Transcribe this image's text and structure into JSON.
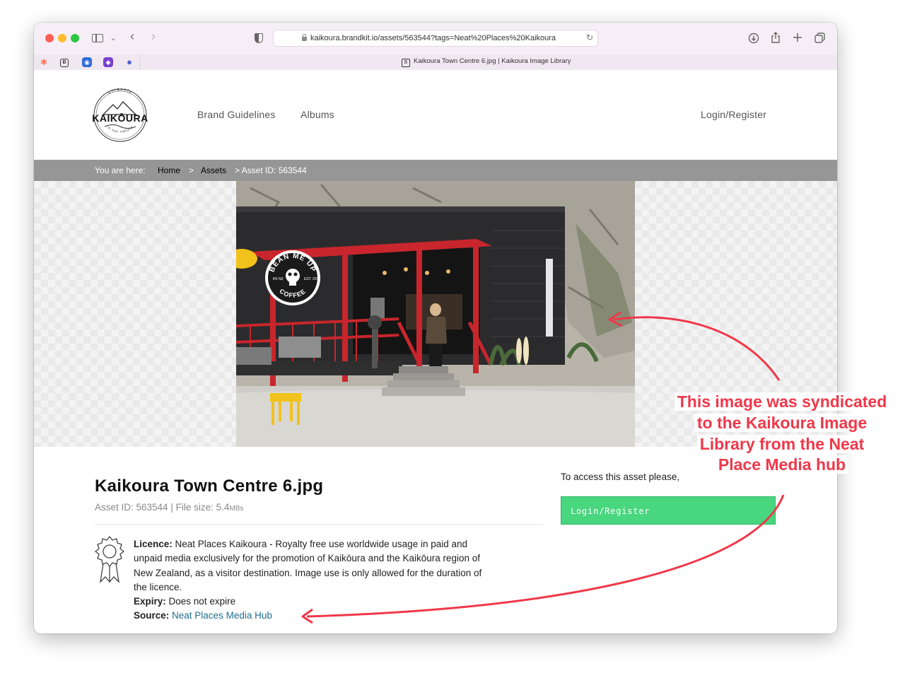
{
  "browser": {
    "url": "kaikoura.brandkit.io/assets/563544?tags=Neat%20Places%20Kaikoura",
    "tab_title": "Kaikoura Town Centre 6.jpg | Kaikoura Image Library",
    "favicon_glyph": "B"
  },
  "site": {
    "logo": {
      "top_text": "uniquely",
      "name": "KAIKŌURA",
      "bottom_text": "in our nature"
    },
    "nav": [
      {
        "label": "Brand Guidelines"
      },
      {
        "label": "Albums"
      }
    ],
    "login_label": "Login/Register"
  },
  "breadcrumb": {
    "prefix": "You are here:",
    "home": "Home",
    "sep": ">",
    "assets": "Assets",
    "current": "> Asset ID: 563544"
  },
  "photo": {
    "sign_top": "BEAN ME UP",
    "sign_bottom": "COFFEE",
    "sign_left": "KK NZ",
    "sign_right": "EST. 2012"
  },
  "asset": {
    "title": "Kaikoura Town Centre 6.jpg",
    "meta_id": "Asset ID: 563544",
    "meta_sep": " | ",
    "meta_size_label": "File size: 5.4",
    "meta_size_unit": "MBs",
    "licence_label": "Licence:",
    "licence_text": " Neat Places Kaikoura - Royalty free use worldwide usage in paid and unpaid media exclusively for the promotion of Kaikōura and the Kaikōura region of New Zealand, as a visitor destination. Image use is only allowed for the duration of the licence.",
    "expiry_label": "Expiry:",
    "expiry_text": " Does not expire",
    "source_label": "Source:",
    "source_link": "Neat Places Media Hub"
  },
  "access": {
    "prompt": "To access this asset please,",
    "button": "Login/Register"
  },
  "annotation": {
    "lines": [
      "This image was syndicated",
      "to the Kaikoura Image",
      "Library from the  Neat",
      "Place Media hub"
    ],
    "color": "#f0384a"
  }
}
